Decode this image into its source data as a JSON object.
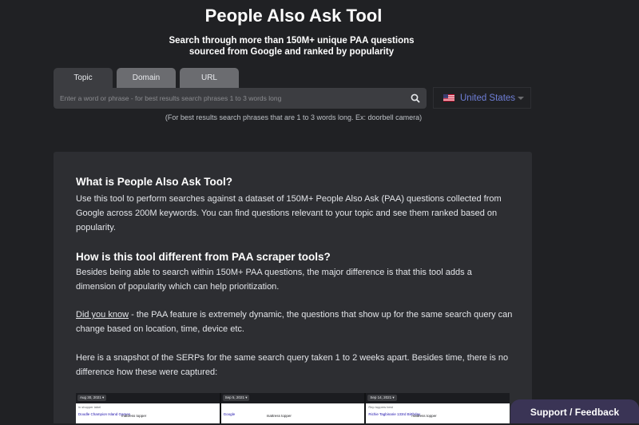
{
  "page": {
    "title": "People Also Ask Tool",
    "subtitle": "Search through more than 150M+ unique PAA questions sourced from Google and ranked by popularity"
  },
  "tabs": [
    {
      "label": "Topic",
      "active": true
    },
    {
      "label": "Domain",
      "active": false
    },
    {
      "label": "URL",
      "active": false
    }
  ],
  "search": {
    "placeholder": "Enter a word or phrase - for best results search phrases 1 to 3 words long",
    "value": "",
    "button_icon": "search-icon"
  },
  "country": {
    "label": "United States",
    "flag_icon": "us-flag-icon",
    "caret_icon": "caret-down-icon"
  },
  "hint": "(For best results search phrases that are 1 to 3 words long. Ex: doorbell camera)",
  "about": {
    "h1": "What is People Also Ask Tool?",
    "p1": "Use this tool to perform searches against a dataset of 150M+ People Also Ask (PAA) questions collected from Google across 200M keywords. You can find questions relevant to your topic and see them ranked based on popularity.",
    "h2": "How is this tool different from PAA scraper tools?",
    "p2": "Besides being able to search within 150M+ PAA questions, the major difference is that this tool adds a dimension of popularity which can help prioritization.",
    "did_you_know": "Did you know",
    "p3": " - the PAA feature is extremely dynamic, the questions that show up for the same search query can change based on location, time, device etc.",
    "p4": "Here is a snapshot of the SERPs for the same search query taken 1 to 2 weeks apart. Besides time, there is no difference how these were captured:"
  },
  "snapshots": [
    {
      "date": "Aug 30, 2021 ▾",
      "row1": "in shopper label",
      "row2": "Doodle Champion Island Games",
      "row2b": "mattress topper"
    },
    {
      "date": "Sep 5, 2021 ▾",
      "row1": "",
      "row2": "Google",
      "row2b": "mattress topper"
    },
    {
      "date": "Sep 14, 2021 ▾",
      "row1": "Rep toppers best",
      "row2": "Richie Tagbinarie 133rd Birthday",
      "row2b": "mattress topper"
    }
  ],
  "feedback_label": "Support / Feedback",
  "colors": {
    "background": "#202124",
    "panel": "#2d2e32",
    "accent": "#6f7fd8",
    "feedback": "#3a3455"
  }
}
